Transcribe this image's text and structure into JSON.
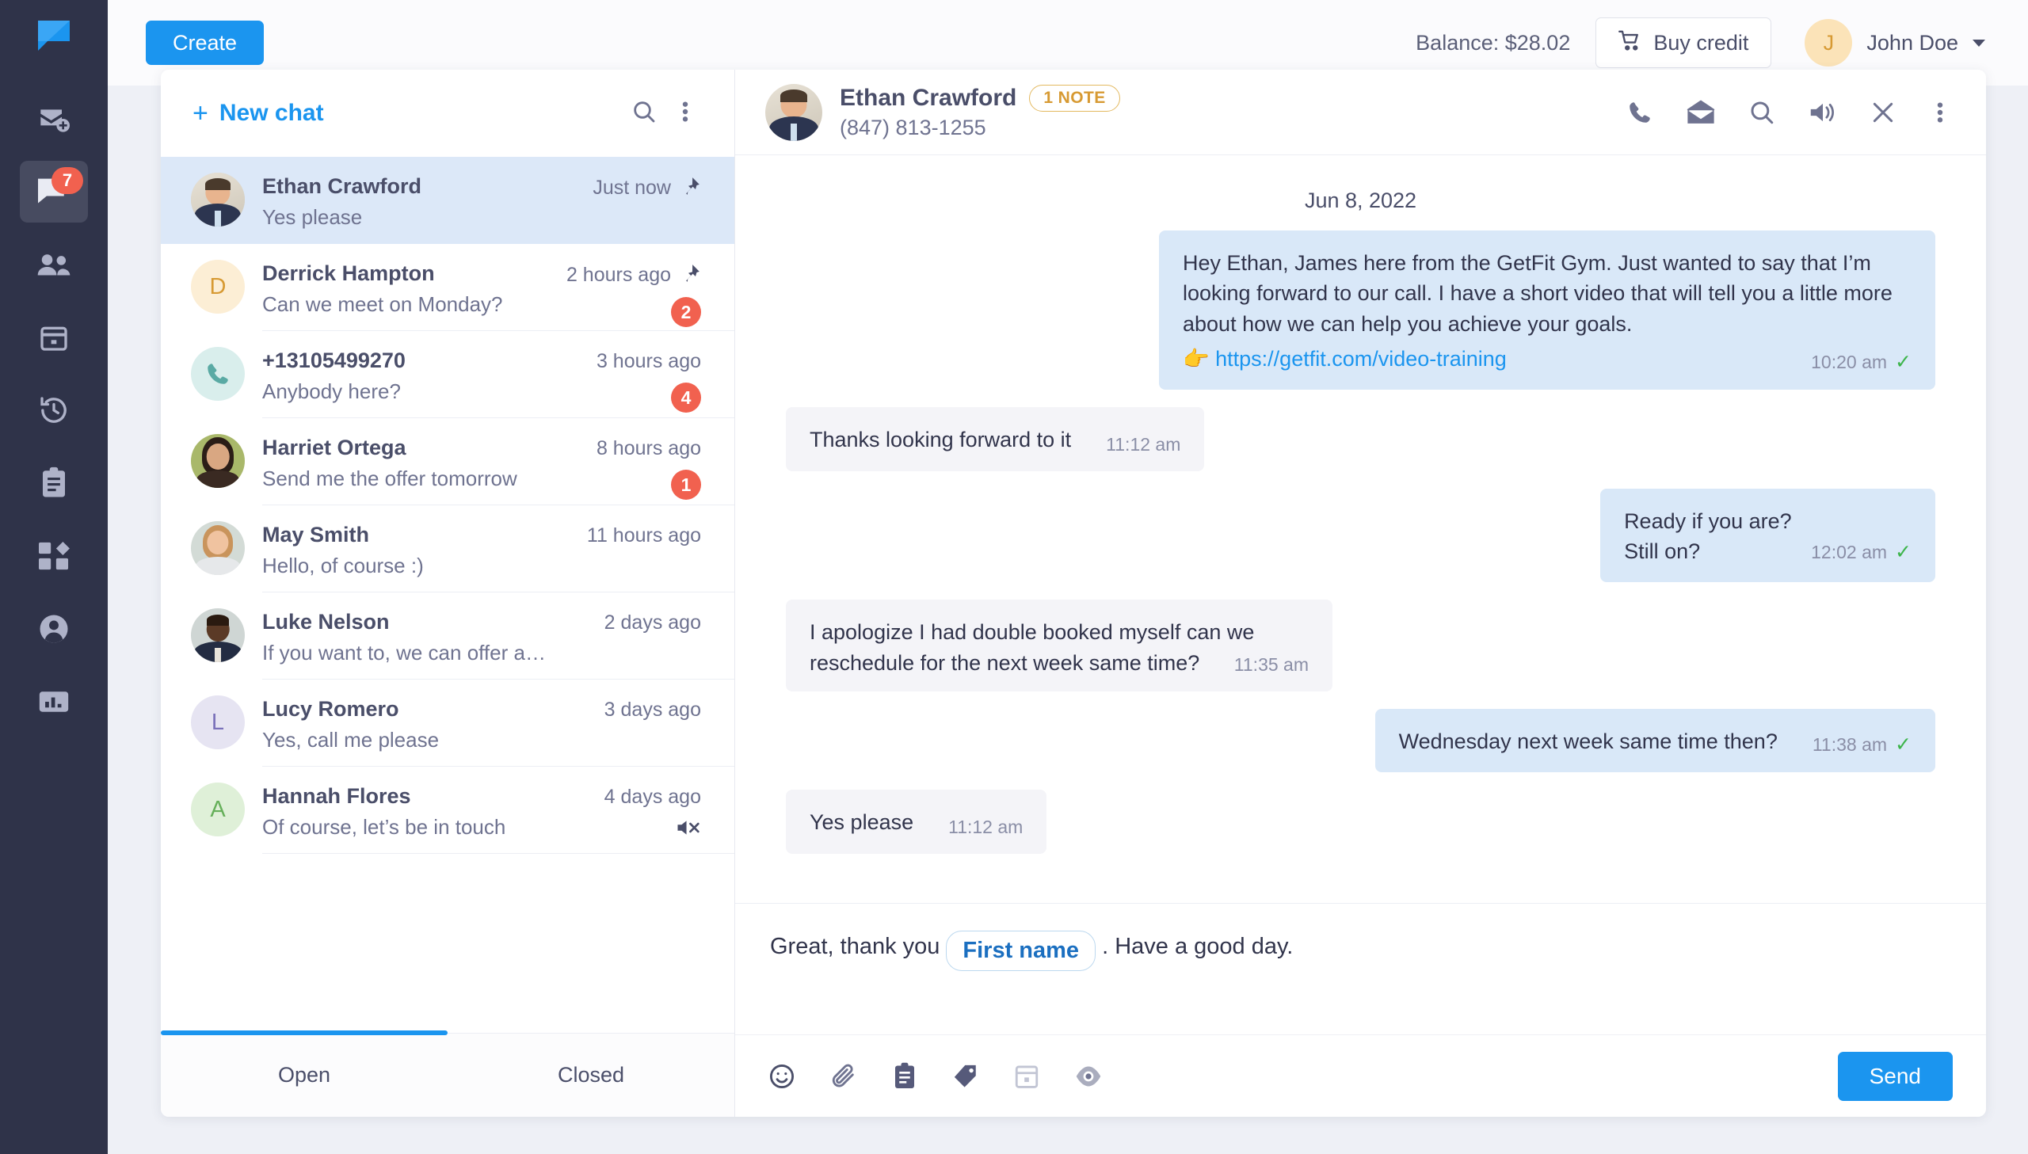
{
  "brand": {
    "logo_name": "chat-logo",
    "accent": "#1b95ef",
    "rail_bg": "#2f3349"
  },
  "rail": {
    "items": [
      {
        "name": "new-email-icon",
        "badge": null
      },
      {
        "name": "chats-icon",
        "badge": "7",
        "active": true
      },
      {
        "name": "contacts-icon",
        "badge": null
      },
      {
        "name": "calendar-icon",
        "badge": null
      },
      {
        "name": "history-icon",
        "badge": null
      },
      {
        "name": "clipboard-icon",
        "badge": null
      },
      {
        "name": "apps-icon",
        "badge": null
      },
      {
        "name": "account-icon",
        "badge": null
      },
      {
        "name": "reports-icon",
        "badge": null
      }
    ]
  },
  "topbar": {
    "create_label": "Create",
    "balance_label": "Balance: $28.02",
    "buy_credit_label": "Buy credit",
    "user_initial": "J",
    "user_name": "John Doe"
  },
  "chat_list": {
    "new_chat_label": "New chat",
    "new_chat_plus": "+",
    "search_icon": "search-icon",
    "more_icon": "more-vertical-icon",
    "tabs": [
      {
        "label": "Open",
        "active": true
      },
      {
        "label": "Closed",
        "active": false
      }
    ],
    "items": [
      {
        "name": "Ethan Crawford",
        "preview": "Yes please",
        "time": "Just now",
        "badge": null,
        "pinned": true,
        "muted": false,
        "selected": true,
        "avatar": {
          "type": "photo",
          "style": "man-suit"
        }
      },
      {
        "name": "Derrick Hampton",
        "preview": "Can we meet on Monday?",
        "time": "2 hours ago",
        "badge": "2",
        "pinned": true,
        "muted": false,
        "selected": false,
        "avatar": {
          "type": "initial",
          "letter": "D",
          "bg": "#fceed5",
          "fg": "#d79a33"
        }
      },
      {
        "name": "+13105499270",
        "preview": "Anybody here?",
        "time": "3 hours ago",
        "badge": "4",
        "pinned": false,
        "muted": false,
        "selected": false,
        "avatar": {
          "type": "phone-icon",
          "bg": "#d9eeec",
          "fg": "#5aaaa4"
        }
      },
      {
        "name": "Harriet Ortega",
        "preview": "Send me the offer tomorrow",
        "time": "8 hours ago",
        "badge": "1",
        "pinned": false,
        "muted": false,
        "selected": false,
        "avatar": {
          "type": "photo",
          "style": "woman-dark"
        }
      },
      {
        "name": "May Smith",
        "preview": "Hello, of course :)",
        "time": "11 hours ago",
        "badge": null,
        "pinned": false,
        "muted": false,
        "selected": false,
        "avatar": {
          "type": "photo",
          "style": "woman-blonde"
        }
      },
      {
        "name": "Luke Nelson",
        "preview": "If you want to, we can offer a new de...",
        "time": "2 days ago",
        "badge": null,
        "pinned": false,
        "muted": false,
        "selected": false,
        "avatar": {
          "type": "photo",
          "style": "man-dark"
        }
      },
      {
        "name": "Lucy Romero",
        "preview": "Yes, call me please",
        "time": "3 days ago",
        "badge": null,
        "pinned": false,
        "muted": false,
        "selected": false,
        "avatar": {
          "type": "initial",
          "letter": "L",
          "bg": "#e6e4f2",
          "fg": "#7b72ba"
        }
      },
      {
        "name": "Hannah Flores",
        "preview": "Of course, let’s be in touch",
        "time": "4 days ago",
        "badge": null,
        "pinned": false,
        "muted": true,
        "selected": false,
        "avatar": {
          "type": "initial",
          "letter": "A",
          "bg": "#dff0d8",
          "fg": "#66b05a"
        }
      }
    ]
  },
  "conversation": {
    "contact_name": "Ethan Crawford",
    "note_badge": "1 NOTE",
    "phone": "(847) 813-1255",
    "actions": [
      "call-icon",
      "mail-icon",
      "search-icon",
      "volume-icon",
      "close-icon",
      "more-vertical-icon"
    ],
    "date_separator": "Jun 8, 2022",
    "messages": [
      {
        "direction": "out",
        "text": "Hey Ethan, James here from the GetFit Gym. Just wanted to say that I’m looking forward to our call. I have a short video that will tell you a little more about how we can help you achieve your goals.",
        "emoji": "👉",
        "link": "https://getfit.com/video-training",
        "time": "10:20 am",
        "status": "delivered"
      },
      {
        "direction": "in",
        "text": "Thanks looking forward to it",
        "time": "11:12 am",
        "status": null
      },
      {
        "direction": "out",
        "text": "Ready if you are?\nStill on?",
        "time": "12:02 am",
        "status": "delivered"
      },
      {
        "direction": "in",
        "text": "I apologize I had double booked myself can we reschedule for the next week same time?",
        "time": "11:35 am",
        "status": null
      },
      {
        "direction": "out",
        "text": "Wednesday next week same time then?",
        "time": "11:38 am",
        "status": "delivered"
      },
      {
        "direction": "in",
        "text": "Yes please",
        "time": "11:12 am",
        "status": null
      }
    ]
  },
  "composer": {
    "text_before": "Great, thank you",
    "merge_tag": "First name",
    "text_after": ". Have a good day.",
    "tools": [
      "emoji-icon",
      "attachment-icon",
      "template-icon",
      "tag-icon",
      "schedule-icon",
      "preview-icon"
    ],
    "send_label": "Send"
  }
}
